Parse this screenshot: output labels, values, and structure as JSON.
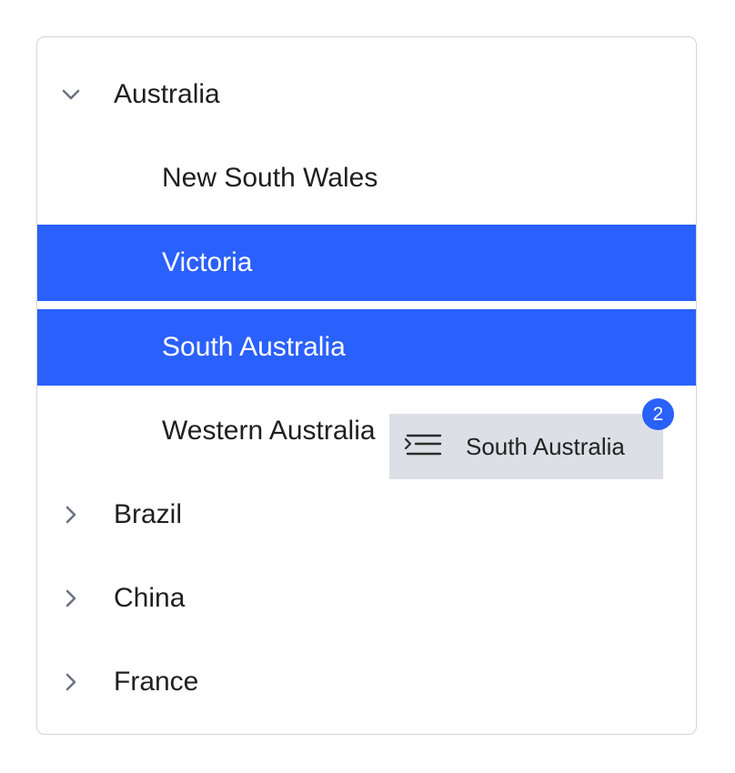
{
  "tree": {
    "items": [
      {
        "label": "Australia",
        "kind": "parent",
        "expanded": true,
        "icon": "chevron-down-icon"
      },
      {
        "label": "New South Wales",
        "kind": "child",
        "selected": false
      },
      {
        "label": "Victoria",
        "kind": "child",
        "selected": true
      },
      {
        "label": "South Australia",
        "kind": "child",
        "selected": true
      },
      {
        "label": "Western Australia",
        "kind": "child",
        "selected": false
      },
      {
        "label": "Brazil",
        "kind": "parent",
        "expanded": false,
        "icon": "chevron-right-icon"
      },
      {
        "label": "China",
        "kind": "parent",
        "expanded": false,
        "icon": "chevron-right-icon"
      },
      {
        "label": "France",
        "kind": "parent",
        "expanded": false,
        "icon": "chevron-right-icon"
      }
    ]
  },
  "drag_preview": {
    "label": "South Australia",
    "count": "2",
    "icon": "drag-handle-icon"
  },
  "colors": {
    "selection": "#2a60fb",
    "drag_background": "#dcdfe5",
    "border": "#d4d4d4",
    "chevron": "#6b7280"
  }
}
